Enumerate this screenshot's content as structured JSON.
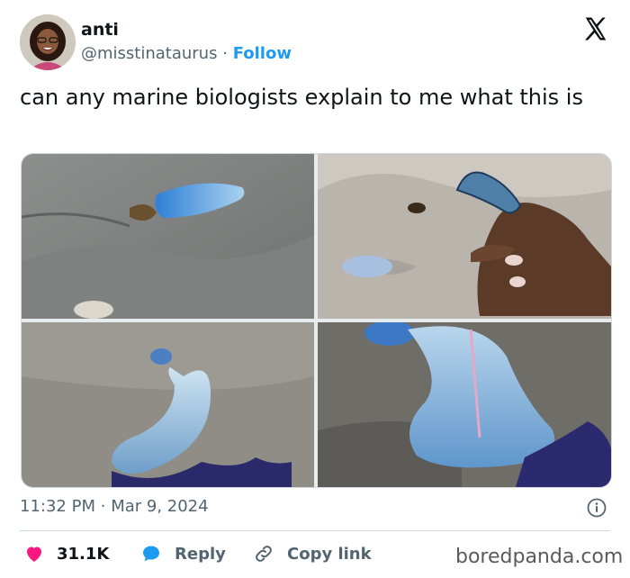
{
  "author": {
    "name": "anti",
    "handle": "@misstinataurus",
    "separator": "·",
    "follow_label": "Follow"
  },
  "platform_icon": "x-logo-icon",
  "tweet": {
    "text": "can any marine biologists explain to me what this is"
  },
  "media": {
    "count": 4,
    "icons": [
      "jellyfish-photo-1",
      "jellyfish-in-hand-photo",
      "jellyfish-photo-3",
      "jellyfish-closeup-photo"
    ]
  },
  "meta": {
    "time": "11:32 PM",
    "separator": "·",
    "date": "Mar 9, 2024",
    "info_icon": "info-icon"
  },
  "actions": {
    "like_count": "31.1K",
    "reply_label": "Reply",
    "copy_label": "Copy link",
    "like_icon": "heart-icon",
    "reply_icon": "speech-bubble-icon",
    "copy_icon": "link-icon"
  },
  "watermark": "boredpanda.com",
  "colors": {
    "accent": "#1d9bf0",
    "like": "#f91880",
    "text": "#0f1419",
    "muted": "#536471"
  }
}
